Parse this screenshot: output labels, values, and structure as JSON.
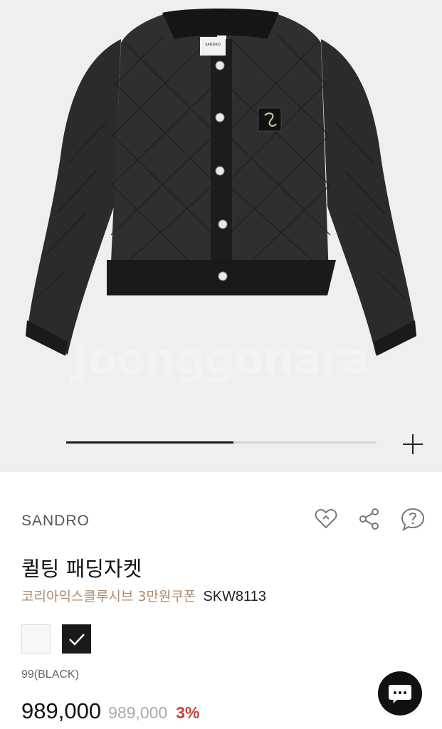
{
  "hero": {
    "watermark": "Joonggonara",
    "slide_progress": 0.54,
    "zoom_icon": "plus-icon",
    "jacket_label": "SANDRO"
  },
  "product": {
    "brand": "SANDRO",
    "title": "퀼팅 패딩자켓",
    "promo": "코리아익스클루시브 3만원쿠폰",
    "code": "SKW8113",
    "selected_color": "99(BLACK)",
    "price": "989,000",
    "original_price": "989,000",
    "discount": "3%"
  },
  "actions": {
    "like_icon": "heart-icon",
    "share_icon": "share-icon",
    "question_icon": "question-bubble-icon"
  },
  "swatches": [
    {
      "name": "white",
      "color": "#f7f7f7",
      "selected": false
    },
    {
      "name": "black",
      "color": "#1a1a1a",
      "selected": true
    }
  ],
  "colors": {
    "promo": "#b08a6a",
    "discount": "#c9423a",
    "hero_bg": "#efefef"
  },
  "chat": {
    "icon": "chat-bubble-icon"
  }
}
